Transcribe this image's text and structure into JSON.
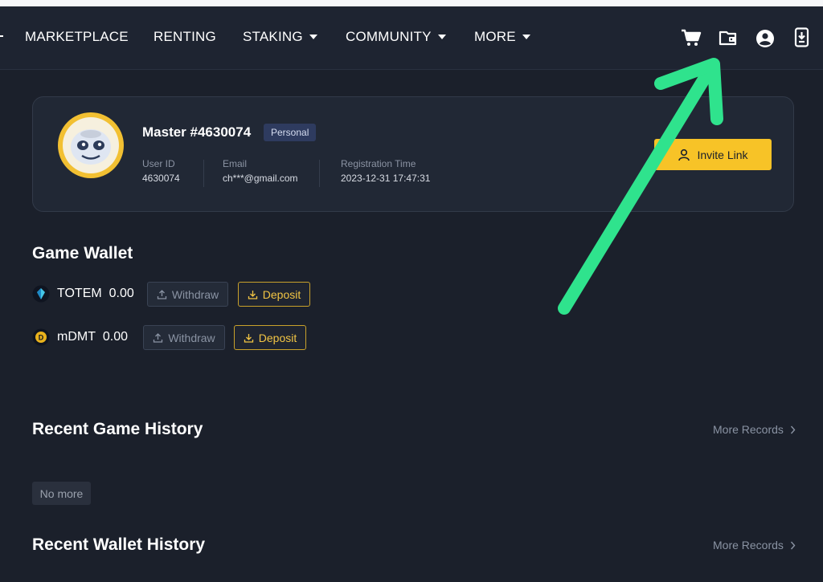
{
  "nav": {
    "items": [
      {
        "label": "MARKETPLACE",
        "dropdown": false
      },
      {
        "label": "RENTING",
        "dropdown": false
      },
      {
        "label": "STAKING",
        "dropdown": true
      },
      {
        "label": "COMMUNITY",
        "dropdown": true
      },
      {
        "label": "MORE",
        "dropdown": true
      }
    ],
    "icons": [
      "cart-icon",
      "wallet-icon",
      "account-icon",
      "download-app-icon"
    ]
  },
  "profile": {
    "name": "Master #4630074",
    "badge": "Personal",
    "user_id_label": "User ID",
    "user_id": "4630074",
    "email_label": "Email",
    "email": "ch***@gmail.com",
    "reg_label": "Registration Time",
    "reg_time": "2023-12-31 17:47:31",
    "invite_label": "Invite Link"
  },
  "wallet": {
    "title": "Game Wallet",
    "coins": [
      {
        "symbol": "TOTEM",
        "amount": "0.00",
        "withdraw": "Withdraw",
        "deposit": "Deposit"
      },
      {
        "symbol": "mDMT",
        "amount": "0.00",
        "withdraw": "Withdraw",
        "deposit": "Deposit"
      }
    ]
  },
  "game_history": {
    "title": "Recent Game History",
    "more": "More Records",
    "empty": "No more"
  },
  "wallet_history": {
    "title": "Recent Wallet History",
    "more": "More Records"
  },
  "colors": {
    "background": "#1b202b",
    "accent_yellow": "#f7c327",
    "annotation_arrow": "#2fe38d"
  }
}
